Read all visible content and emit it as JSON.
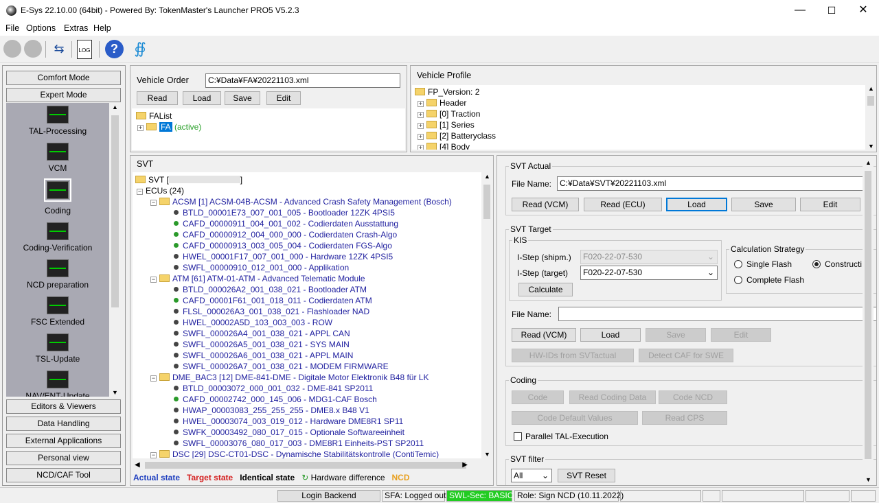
{
  "window": {
    "title": "E-Sys 22.10.00  (64bit) - Powered By: TokenMaster's Launcher PRO5 V5.2.3"
  },
  "menu": [
    "File",
    "Options",
    "Extras",
    "Help"
  ],
  "modes": {
    "comfort": "Comfort Mode",
    "expert": "Expert Mode"
  },
  "tools": [
    "TAL-Processing",
    "VCM",
    "Coding",
    "Coding-Verification",
    "NCD preparation",
    "FSC Extended",
    "TSL-Update",
    "NAV/ENT-Update"
  ],
  "bottom_buttons": [
    "Editors & Viewers",
    "Data Handling",
    "External Applications",
    "Personal view",
    "NCD/CAF Tool"
  ],
  "vehicle_order": {
    "label": "Vehicle Order",
    "file": "C:¥Data¥FA¥20221103.xml",
    "buttons": [
      "Read",
      "Load",
      "Save",
      "Edit"
    ],
    "falist": "FAList",
    "fa": "FA",
    "active": "(active)"
  },
  "vehicle_profile": {
    "title": "Vehicle Profile",
    "root": "FP_Version: 2",
    "items": [
      "Header",
      "[0] Traction",
      "[1] Series",
      "[2] Batteryclass",
      "[4] Body"
    ]
  },
  "svt": {
    "title": "SVT",
    "root": "SVT [",
    "root_end": "]",
    "ecus": "ECUs (24)",
    "groups": [
      {
        "name": "ACSM [1] ACSM-04B-ACSM - Advanced Crash Safety Management (Bosch)",
        "items": [
          {
            "t": "BTLD_00001E73_007_001_005 - Bootloader 12ZK 4PSI5",
            "g": false
          },
          {
            "t": "CAFD_00000911_004_001_002 - Codierdaten Ausstattung",
            "g": true
          },
          {
            "t": "CAFD_00000912_004_000_000 - Codierdaten Crash-Algo",
            "g": true
          },
          {
            "t": "CAFD_00000913_003_005_004 - Codierdaten FGS-Algo",
            "g": true
          },
          {
            "t": "HWEL_00001F17_007_001_000 - Hardware 12ZK 4PSI5",
            "g": false
          },
          {
            "t": "SWFL_00000910_012_001_000 - Applikation",
            "g": false
          }
        ]
      },
      {
        "name": "ATM [61] ATM-01-ATM - Advanced Telematic Module",
        "items": [
          {
            "t": "BTLD_000026A2_001_038_021 - Bootloader ATM",
            "g": false
          },
          {
            "t": "CAFD_00001F61_001_018_011 - Codierdaten ATM",
            "g": true
          },
          {
            "t": "FLSL_000026A3_001_038_021 - Flashloader NAD",
            "g": false
          },
          {
            "t": "HWEL_00002A5D_103_003_003 - ROW",
            "g": false
          },
          {
            "t": "SWFL_000026A4_001_038_021 - APPL CAN",
            "g": false
          },
          {
            "t": "SWFL_000026A5_001_038_021 - SYS MAIN",
            "g": false
          },
          {
            "t": "SWFL_000026A6_001_038_021 - APPL MAIN",
            "g": false
          },
          {
            "t": "SWFL_000026A7_001_038_021 - MODEM FIRMWARE",
            "g": false
          }
        ]
      },
      {
        "name": "DME_BAC3 [12] DME-841-DME - Digitale Motor Elektronik B48 für LK",
        "items": [
          {
            "t": "BTLD_00003072_000_001_032 - DME-841 SP2011",
            "g": false
          },
          {
            "t": "CAFD_00002742_000_145_006 - MDG1-CAF Bosch",
            "g": true
          },
          {
            "t": "HWAP_00003083_255_255_255 - DME8.x B48 V1",
            "g": false
          },
          {
            "t": "HWEL_00003074_003_019_012 - Hardware DME8R1 SP11",
            "g": false
          },
          {
            "t": "SWFK_00003492_080_017_015 - Optionale Softwareeinheit",
            "g": false
          },
          {
            "t": "SWFL_00003076_080_017_003 - DME8R1 Einheits-PST SP2011",
            "g": false
          }
        ]
      },
      {
        "name": "DSC [29] DSC-CT01-DSC - Dynamische Stabilitätskontrolle (ContiTemic)",
        "items": []
      }
    ]
  },
  "legend": {
    "actual": "Actual state",
    "target": "Target state",
    "identical": "Identical state",
    "hw": "Hardware difference",
    "ncd": "NCD"
  },
  "svt_actual": {
    "title": "SVT Actual",
    "file_label": "File Name:",
    "file": "C:¥Data¥SVT¥20221103.xml",
    "buttons": [
      "Read (VCM)",
      "Read (ECU)",
      "Load",
      "Save",
      "Edit"
    ]
  },
  "svt_target": {
    "title": "SVT Target",
    "kis": "KIS",
    "istep_shipm_label": "I-Step (shipm.)",
    "istep_shipm": "F020-22-07-530",
    "istep_target_label": "I-Step (target)",
    "istep_target": "F020-22-07-530",
    "calculate": "Calculate",
    "strategy": {
      "title": "Calculation Strategy",
      "single": "Single Flash",
      "construction": "Constructi",
      "complete": "Complete Flash"
    },
    "file_label": "File Name:",
    "buttons": [
      "Read (VCM)",
      "Load",
      "Save",
      "Edit"
    ],
    "hwids": "HW-IDs from SVTactual",
    "detect": "Detect CAF for SWE"
  },
  "coding": {
    "title": "Coding",
    "buttons": [
      "Code",
      "Read Coding Data",
      "Code NCD"
    ],
    "defaults": "Code Default Values",
    "readcps": "Read CPS",
    "parallel": "Parallel TAL-Execution"
  },
  "svt_filter": {
    "title": "SVT filter",
    "value": "All",
    "reset": "SVT Reset"
  },
  "status": {
    "login": "Login Backend",
    "sfa": "SFA: Logged out",
    "swl": "SWL-Sec: BASIC",
    "role": "Role: Sign NCD (10.11.2022)"
  },
  "colors": {
    "actual": "#1f3fbf",
    "target": "#d42020",
    "swl_bg": "#22cc22",
    "ncd": "#e8a020"
  }
}
